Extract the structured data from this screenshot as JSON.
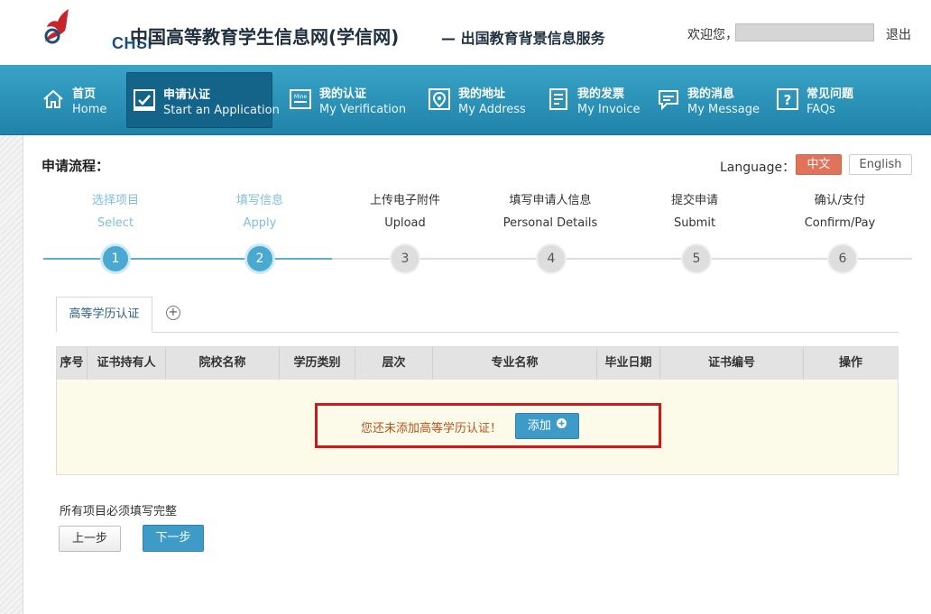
{
  "header": {
    "logo_text": "CHSI",
    "site_title": "中国高等教育学生信息网(学信网)",
    "site_subtitle": "— 出国教育背景信息服务",
    "welcome": "欢迎您，",
    "logout": "退出"
  },
  "nav": {
    "items": [
      {
        "label": "首页",
        "label_en": "Home",
        "icon": "home-icon"
      },
      {
        "label": "申请认证",
        "label_en": "Start an Application",
        "icon": "checkbox-form-icon"
      },
      {
        "label": "我的认证",
        "label_en": "My Verification",
        "icon": "certificate-icon"
      },
      {
        "label": "我的地址",
        "label_en": "My Address",
        "icon": "location-pin-icon"
      },
      {
        "label": "我的发票",
        "label_en": "My Invoice",
        "icon": "invoice-icon"
      },
      {
        "label": "我的消息",
        "label_en": "My Message",
        "icon": "message-icon"
      },
      {
        "label": "常见问题",
        "label_en": "FAQs",
        "icon": "question-icon"
      }
    ],
    "active_index": 1
  },
  "flow": {
    "title": "申请流程：",
    "language_label": "Language：",
    "lang_zh": "中文",
    "lang_en": "English",
    "steps": [
      {
        "zh": "选择项目",
        "en": "Select",
        "num": "1",
        "done": true
      },
      {
        "zh": "填写信息",
        "en": "Apply",
        "num": "2",
        "done": true
      },
      {
        "zh": "上传电子附件",
        "en": "Upload",
        "num": "3",
        "done": false
      },
      {
        "zh": "填写申请人信息",
        "en": "Personal Details",
        "num": "4",
        "done": false
      },
      {
        "zh": "提交申请",
        "en": "Submit",
        "num": "5",
        "done": false
      },
      {
        "zh": "确认/支付",
        "en": "Confirm/Pay",
        "num": "6",
        "done": false
      }
    ]
  },
  "tabs": {
    "active_label": "高等学历认证",
    "add_symbol": "+"
  },
  "table": {
    "columns": [
      "序号",
      "证书持有人",
      "院校名称",
      "学历类别",
      "层次",
      "专业名称",
      "毕业日期",
      "证书编号",
      "操作"
    ],
    "empty_message": "您还未添加高等学历认证！",
    "add_button": "添加"
  },
  "footer": {
    "required_note": "所有项目必须填写完整",
    "prev_button": "上一步",
    "next_button": "下一步"
  },
  "colors": {
    "nav_bg": "#2a93b8",
    "accent_blue": "#3e9bc7",
    "lang_active": "#e0735a",
    "highlight_red": "#cc1a1a",
    "empty_row_bg": "#fcfae9"
  }
}
